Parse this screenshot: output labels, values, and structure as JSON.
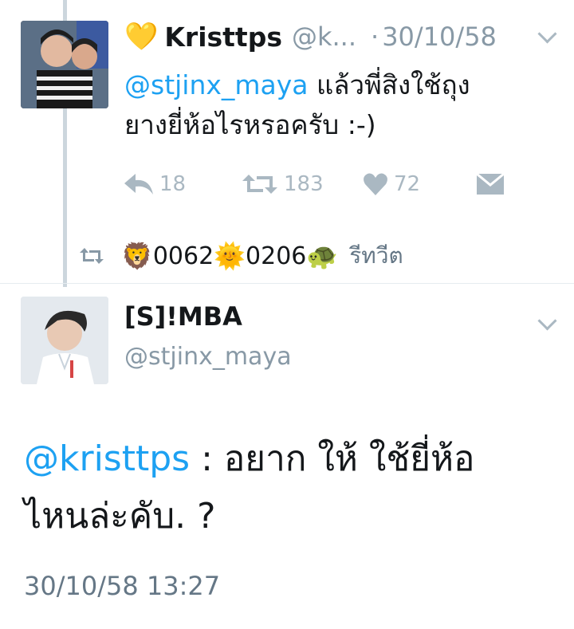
{
  "tweet1": {
    "emoji": "💛",
    "display_name": "Kristtps",
    "handle": "@k...",
    "date_separator": "·",
    "date": "30/10/58",
    "mention": "@stjinx_maya",
    "text_line1_rest": " แล้วพี่สิงใช้ถุง",
    "text_line2": "ยางยี่ห้อไรหรอครับ :-)",
    "actions": {
      "reply": "18",
      "retweet": "183",
      "like": "72"
    }
  },
  "retweet_bar": {
    "emoji_lion": "🦁",
    "num1": "0062",
    "emoji_sun": "🌞",
    "num2": "0206",
    "emoji_turtle": "🐢",
    "label": "รีทวีต"
  },
  "tweet2": {
    "display_name": "[S]!MBA",
    "handle": "@stjinx_maya",
    "mention": "@kristtps",
    "text_line1_rest": " : อยาก ให้ ใช้ยี่ห้อ",
    "text_line2": "ไหนล่ะคับ. ?",
    "timestamp": "30/10/58 13:27"
  }
}
